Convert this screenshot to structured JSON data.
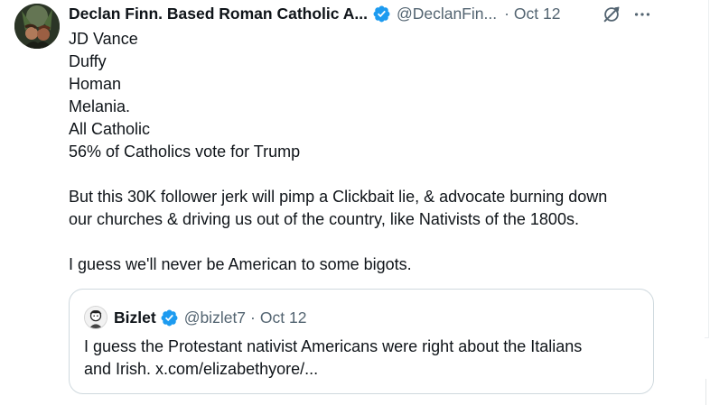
{
  "tweet": {
    "author": {
      "display_name": "Declan Finn. Based Roman Catholic A...",
      "handle": "@DeclanFin...",
      "verified": true
    },
    "separator": "·",
    "date": "Oct 12",
    "lines": [
      "JD Vance",
      "Duffy",
      "Homan",
      "Melania.",
      "All Catholic",
      "56% of Catholics vote for Trump",
      "",
      "But this 30K follower jerk will pimp a Clickbait lie, & advocate burning down",
      "our churches & driving us out of the country, like Nativists of the 1800s.",
      "",
      "I guess we'll never be American to some bigots."
    ],
    "icons": {
      "grok": "grok-icon",
      "more": "more-icon",
      "verified": "verified-badge-icon"
    }
  },
  "quote": {
    "author": {
      "display_name": "Bizlet",
      "handle": "@bizlet7",
      "verified": true
    },
    "separator": "·",
    "date": "Oct 12",
    "lines": [
      "I guess the Protestant nativist Americans were right about the Italians",
      "and Irish. x.com/elizabethyore/..."
    ]
  },
  "colors": {
    "text": "#0f1419",
    "secondary": "#536471",
    "verified": "#1d9bf0",
    "border": "#cfd9de"
  }
}
